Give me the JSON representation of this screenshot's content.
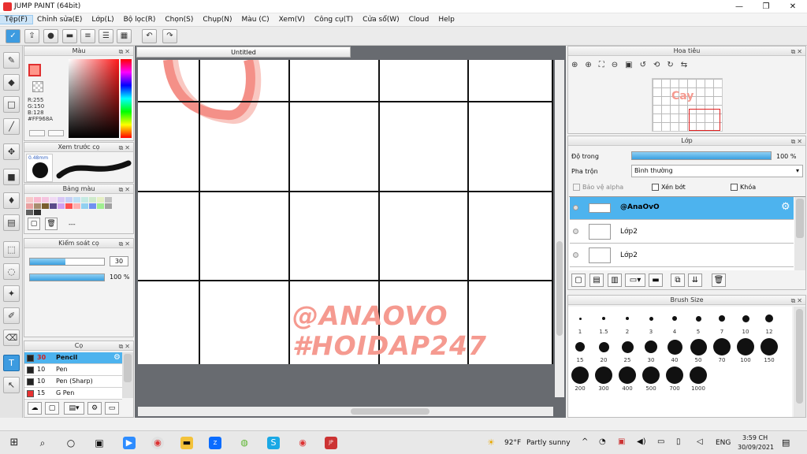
{
  "window": {
    "title": "JUMP PAINT (64bit)",
    "minimize": "—",
    "maximize": "❐",
    "close": "✕"
  },
  "menu": [
    "Tệp(F)",
    "Chỉnh sửa(E)",
    "Lớp(L)",
    "Bộ lọc(R)",
    "Chọn(S)",
    "Chụp(N)",
    "Màu (C)",
    "Xem(V)",
    "Công cụ(T)",
    "Cửa sổ(W)",
    "Cloud",
    "Help"
  ],
  "color_panel": {
    "title": "Màu",
    "r": "R:255",
    "g": "G:150",
    "b": "B:128",
    "hex": "#FF968A",
    "main": "#ff968a"
  },
  "brush_preview": {
    "title": "Xem trước cọ",
    "size": "0.48mm"
  },
  "palette": {
    "title": "Bảng màu",
    "label": "---",
    "colors": [
      "#f7c9c9",
      "#f9b9cf",
      "#f5c4e0",
      "#f0d9f3",
      "#d9c6f5",
      "#c6cff5",
      "#bfe0f5",
      "#c5eae3",
      "#cfeacb",
      "#e6f0c4",
      "#c1c1c1",
      "#e9a0a0",
      "#a78c6e",
      "#7a5e2e",
      "#5a4a8a",
      "#d0a0f0",
      "#ff5050",
      "#ffb0b0",
      "#90d0f0",
      "#7090f0",
      "#a0f090",
      "#a0a0a0",
      "#606060",
      "#303030"
    ]
  },
  "brush_control": {
    "title": "Kiểm soát cọ",
    "size": "30",
    "opacity": "100 %",
    "size_fraction": 0.48,
    "opacity_fraction": 1.0
  },
  "brush_list": {
    "title": "Cọ",
    "items": [
      {
        "size": "30",
        "name": "Pencil",
        "color": "#222222"
      },
      {
        "size": "10",
        "name": "Pen",
        "color": "#222222"
      },
      {
        "size": "10",
        "name": "Pen (Sharp)",
        "color": "#222222"
      },
      {
        "size": "15",
        "name": "G Pen",
        "color": "#e83030"
      }
    ]
  },
  "document": {
    "tab": "Untitled",
    "watermark_line1": "@ANAOVO",
    "watermark_line2": "#HOIDAP247",
    "canvas_preview": "Cay"
  },
  "navigator": {
    "title": "Hoa tiêu"
  },
  "layer_panel": {
    "title": "Lớp",
    "opacity_label": "Độ trong",
    "opacity_value": "100 %",
    "opacity_fraction": 1.0,
    "blend_label": "Pha trộn",
    "blend_value": "Bình thường",
    "protect_alpha": "Bảo vệ alpha",
    "clip": "Xén bớt",
    "lock": "Khóa",
    "layers": [
      "@AnaOvO",
      "Lớp2",
      "Lớp2"
    ]
  },
  "brush_size": {
    "title": "Brush Size",
    "sizes": [
      "1",
      "1.5",
      "2",
      "3",
      "4",
      "5",
      "7",
      "10",
      "12",
      "15",
      "20",
      "25",
      "30",
      "40",
      "50",
      "70",
      "100",
      "150",
      "200",
      "300",
      "400",
      "500",
      "700",
      "1000"
    ]
  },
  "taskbar": {
    "weather_temp": "92°F",
    "weather_text": "Partly sunny",
    "lang": "ENG",
    "time": "3:59 CH",
    "date": "30/09/2021"
  }
}
